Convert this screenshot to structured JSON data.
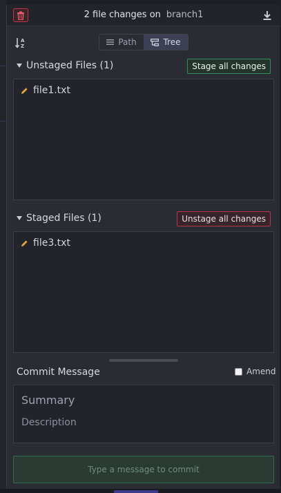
{
  "header": {
    "title": "2 file changes on",
    "branch": "branch1"
  },
  "view_toggle": {
    "path_label": "Path",
    "tree_label": "Tree",
    "selected": "Tree"
  },
  "unstaged": {
    "title": "Unstaged Files (1)",
    "action_label": "Stage all changes",
    "files": [
      {
        "name": "file1.txt",
        "status": "modified"
      }
    ]
  },
  "staged": {
    "title": "Staged Files (1)",
    "action_label": "Unstage all changes",
    "files": [
      {
        "name": "file3.txt",
        "status": "modified"
      }
    ]
  },
  "commit": {
    "label": "Commit Message",
    "amend_label": "Amend",
    "amend_checked": false,
    "summary_placeholder": "Summary",
    "description_placeholder": "Description",
    "button_label": "Type a message to commit"
  },
  "colors": {
    "accent_green": "#2f8f5a",
    "accent_red": "#b8354d",
    "modified_icon": "#e8a23c",
    "tree_active": "#3c3f56"
  },
  "icons": {
    "discard": "trash-icon",
    "export": "download-icon",
    "sort": "sort-az-icon",
    "path": "list-icon",
    "tree": "tree-icon",
    "modified": "pencil-icon"
  }
}
